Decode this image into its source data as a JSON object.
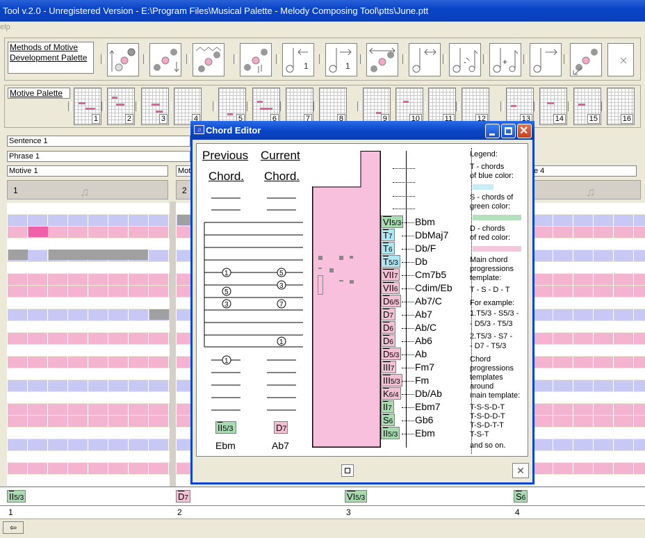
{
  "app": {
    "title": "Tool v.2.0 - Unregistered Version - E:\\Program Files\\Musical Palette - Melody Composing Tool\\ptts\\June.ptt",
    "menu_fragment": "elp"
  },
  "palettes": {
    "methods_label": "Methods of Motive Development Palette",
    "motive_label": "Motive Palette",
    "motive_numbers": [
      "1",
      "2",
      "3",
      "4",
      "5",
      "6",
      "7",
      "8",
      "9",
      "10",
      "11",
      "12",
      "13",
      "14",
      "15",
      "16"
    ]
  },
  "structure": {
    "sentence": "Sentence 1",
    "phrase": "Phrase 1",
    "motive1": "Motive 1",
    "motive2_frag": "Mot",
    "motive4_frag": "e 4",
    "measure1": "1",
    "measure2": "2"
  },
  "chord_editor": {
    "title": "Chord Editor",
    "previous_label": "Previous",
    "current_label": "Current",
    "chord_word": "Chord.",
    "previous_chord": {
      "badge": "II",
      "sub": "5/3",
      "name": "Ebm"
    },
    "current_chord": {
      "badge": "D",
      "sub": "7",
      "name": "Ab7"
    },
    "chords": [
      {
        "badge": "VI",
        "sub": "5/3",
        "name": "Bbm",
        "color": "green"
      },
      {
        "badge": "T",
        "sub": "7",
        "name": "DbMaj7",
        "color": "blue"
      },
      {
        "badge": "T",
        "sub": "6",
        "name": "Db/F",
        "color": "blue"
      },
      {
        "badge": "T",
        "sub": "5/3",
        "name": "Db",
        "color": "blue"
      },
      {
        "badge": "VII",
        "sub": "7",
        "name": "Cm7b5",
        "color": "red"
      },
      {
        "badge": "VII",
        "sub": "6",
        "name": "Cdim/Eb",
        "color": "red"
      },
      {
        "badge": "D",
        "sub": "6/5",
        "name": "Ab7/C",
        "color": "red"
      },
      {
        "badge": "D",
        "sub": "7",
        "name": "Ab7",
        "color": "red"
      },
      {
        "badge": "D",
        "sub": "6",
        "name": "Ab/C",
        "color": "red"
      },
      {
        "badge": "D",
        "sub": "6",
        "name": "Ab6",
        "color": "red"
      },
      {
        "badge": "D",
        "sub": "5/3",
        "name": "Ab",
        "color": "red"
      },
      {
        "badge": "III",
        "sub": "7",
        "name": "Fm7",
        "color": "red"
      },
      {
        "badge": "III",
        "sub": "5/3",
        "name": "Fm",
        "color": "red"
      },
      {
        "badge": "K",
        "sub": "6/4",
        "name": "Db/Ab",
        "color": "red"
      },
      {
        "badge": "II",
        "sub": "7",
        "name": "Ebm7",
        "color": "green"
      },
      {
        "badge": "S",
        "sub": "6",
        "name": "Gb6",
        "color": "green"
      },
      {
        "badge": "II",
        "sub": "5/3",
        "name": "Ebm",
        "color": "green"
      }
    ],
    "legend": [
      "Legend:",
      "T - chords",
      "of blue color:",
      "S - chords of",
      "green color:",
      "D - chords",
      "of red color:",
      "Main chord",
      "progressions",
      "template:",
      "T - S - D - T",
      "For example:",
      "1.T5/3 - S5/3 -",
      "- D5/3 - T5/3",
      "2.T5/3 - S7 -",
      "- D7 - T5/3",
      "Chord",
      "progressions",
      "templates",
      "around",
      "main template:",
      "T-S-S-D-T",
      "T-S-D-D-T",
      "T-S-D-T-T",
      "T-S-T",
      "and so on."
    ],
    "colors": {
      "blue": "#aee6f4",
      "green": "#a8dcb0",
      "red": "#f4c0d4"
    }
  },
  "timeline": {
    "chords": [
      {
        "badge": "II",
        "sub": "5/3"
      },
      {
        "badge": "D",
        "sub": "7"
      },
      {
        "badge": "VI",
        "sub": "5/3"
      },
      {
        "badge": "S",
        "sub": "6"
      }
    ],
    "measures": [
      "1",
      "2",
      "3",
      "4"
    ]
  }
}
